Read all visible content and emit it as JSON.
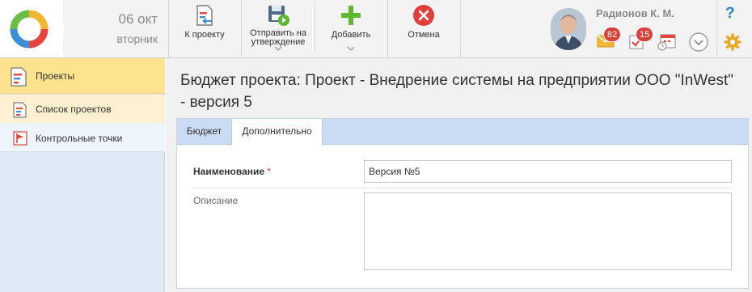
{
  "header": {
    "date_day": "06 окт",
    "date_weekday": "вторник",
    "toolbar": [
      {
        "key": "to_project",
        "label": "К проекту",
        "icon": "back-to-project-icon"
      },
      {
        "key": "send_approval",
        "label": "Отправить на утверждение",
        "icon": "send-for-approval-icon",
        "has_dropdown": true
      },
      {
        "key": "add",
        "label": "Добавить",
        "icon": "plus-icon",
        "has_dropdown": true
      },
      {
        "key": "cancel",
        "label": "Отмена",
        "icon": "cancel-icon"
      }
    ],
    "user_name": "Радионов К. М.",
    "mail_count": "82",
    "tasks_count": "15",
    "help_label": "?"
  },
  "sidebar": {
    "items": [
      {
        "label": "Проекты",
        "icon": "projects-icon",
        "active": true
      },
      {
        "label": "Список проектов",
        "icon": "project-list-icon"
      },
      {
        "label": "Контрольные точки",
        "icon": "milestones-icon"
      }
    ]
  },
  "main": {
    "title": "Бюджет проекта: Проект - Внедрение системы на предприятии ООО \"InWest\" - версия 5",
    "tabs": [
      {
        "label": "Бюджет",
        "active": false
      },
      {
        "label": "Дополнительно",
        "active": true
      }
    ],
    "form": {
      "name_label": "Наименование",
      "required_mark": "*",
      "name_value": "Версия №5",
      "description_label": "Описание",
      "description_value": ""
    }
  },
  "colors": {
    "accent_blue": "#2f7fc5",
    "badge_red": "#d9413d",
    "plus_green": "#5cb82e",
    "cancel_red": "#e0403c",
    "sidebar_active": "#fde38e",
    "tabs_bg": "#c9dcf3"
  }
}
